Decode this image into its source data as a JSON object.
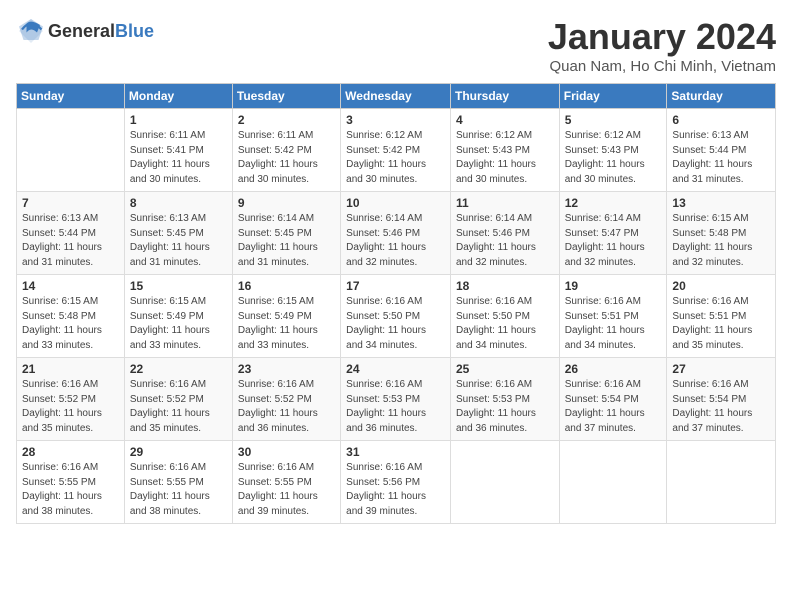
{
  "header": {
    "logo": {
      "text_general": "General",
      "text_blue": "Blue"
    },
    "title": "January 2024",
    "location": "Quan Nam, Ho Chi Minh, Vietnam"
  },
  "calendar": {
    "weekdays": [
      "Sunday",
      "Monday",
      "Tuesday",
      "Wednesday",
      "Thursday",
      "Friday",
      "Saturday"
    ],
    "weeks": [
      [
        {
          "day": "",
          "sunrise": "",
          "sunset": "",
          "daylight": ""
        },
        {
          "day": "1",
          "sunrise": "Sunrise: 6:11 AM",
          "sunset": "Sunset: 5:41 PM",
          "daylight": "Daylight: 11 hours and 30 minutes."
        },
        {
          "day": "2",
          "sunrise": "Sunrise: 6:11 AM",
          "sunset": "Sunset: 5:42 PM",
          "daylight": "Daylight: 11 hours and 30 minutes."
        },
        {
          "day": "3",
          "sunrise": "Sunrise: 6:12 AM",
          "sunset": "Sunset: 5:42 PM",
          "daylight": "Daylight: 11 hours and 30 minutes."
        },
        {
          "day": "4",
          "sunrise": "Sunrise: 6:12 AM",
          "sunset": "Sunset: 5:43 PM",
          "daylight": "Daylight: 11 hours and 30 minutes."
        },
        {
          "day": "5",
          "sunrise": "Sunrise: 6:12 AM",
          "sunset": "Sunset: 5:43 PM",
          "daylight": "Daylight: 11 hours and 30 minutes."
        },
        {
          "day": "6",
          "sunrise": "Sunrise: 6:13 AM",
          "sunset": "Sunset: 5:44 PM",
          "daylight": "Daylight: 11 hours and 31 minutes."
        }
      ],
      [
        {
          "day": "7",
          "sunrise": "Sunrise: 6:13 AM",
          "sunset": "Sunset: 5:44 PM",
          "daylight": "Daylight: 11 hours and 31 minutes."
        },
        {
          "day": "8",
          "sunrise": "Sunrise: 6:13 AM",
          "sunset": "Sunset: 5:45 PM",
          "daylight": "Daylight: 11 hours and 31 minutes."
        },
        {
          "day": "9",
          "sunrise": "Sunrise: 6:14 AM",
          "sunset": "Sunset: 5:45 PM",
          "daylight": "Daylight: 11 hours and 31 minutes."
        },
        {
          "day": "10",
          "sunrise": "Sunrise: 6:14 AM",
          "sunset": "Sunset: 5:46 PM",
          "daylight": "Daylight: 11 hours and 32 minutes."
        },
        {
          "day": "11",
          "sunrise": "Sunrise: 6:14 AM",
          "sunset": "Sunset: 5:46 PM",
          "daylight": "Daylight: 11 hours and 32 minutes."
        },
        {
          "day": "12",
          "sunrise": "Sunrise: 6:14 AM",
          "sunset": "Sunset: 5:47 PM",
          "daylight": "Daylight: 11 hours and 32 minutes."
        },
        {
          "day": "13",
          "sunrise": "Sunrise: 6:15 AM",
          "sunset": "Sunset: 5:48 PM",
          "daylight": "Daylight: 11 hours and 32 minutes."
        }
      ],
      [
        {
          "day": "14",
          "sunrise": "Sunrise: 6:15 AM",
          "sunset": "Sunset: 5:48 PM",
          "daylight": "Daylight: 11 hours and 33 minutes."
        },
        {
          "day": "15",
          "sunrise": "Sunrise: 6:15 AM",
          "sunset": "Sunset: 5:49 PM",
          "daylight": "Daylight: 11 hours and 33 minutes."
        },
        {
          "day": "16",
          "sunrise": "Sunrise: 6:15 AM",
          "sunset": "Sunset: 5:49 PM",
          "daylight": "Daylight: 11 hours and 33 minutes."
        },
        {
          "day": "17",
          "sunrise": "Sunrise: 6:16 AM",
          "sunset": "Sunset: 5:50 PM",
          "daylight": "Daylight: 11 hours and 34 minutes."
        },
        {
          "day": "18",
          "sunrise": "Sunrise: 6:16 AM",
          "sunset": "Sunset: 5:50 PM",
          "daylight": "Daylight: 11 hours and 34 minutes."
        },
        {
          "day": "19",
          "sunrise": "Sunrise: 6:16 AM",
          "sunset": "Sunset: 5:51 PM",
          "daylight": "Daylight: 11 hours and 34 minutes."
        },
        {
          "day": "20",
          "sunrise": "Sunrise: 6:16 AM",
          "sunset": "Sunset: 5:51 PM",
          "daylight": "Daylight: 11 hours and 35 minutes."
        }
      ],
      [
        {
          "day": "21",
          "sunrise": "Sunrise: 6:16 AM",
          "sunset": "Sunset: 5:52 PM",
          "daylight": "Daylight: 11 hours and 35 minutes."
        },
        {
          "day": "22",
          "sunrise": "Sunrise: 6:16 AM",
          "sunset": "Sunset: 5:52 PM",
          "daylight": "Daylight: 11 hours and 35 minutes."
        },
        {
          "day": "23",
          "sunrise": "Sunrise: 6:16 AM",
          "sunset": "Sunset: 5:52 PM",
          "daylight": "Daylight: 11 hours and 36 minutes."
        },
        {
          "day": "24",
          "sunrise": "Sunrise: 6:16 AM",
          "sunset": "Sunset: 5:53 PM",
          "daylight": "Daylight: 11 hours and 36 minutes."
        },
        {
          "day": "25",
          "sunrise": "Sunrise: 6:16 AM",
          "sunset": "Sunset: 5:53 PM",
          "daylight": "Daylight: 11 hours and 36 minutes."
        },
        {
          "day": "26",
          "sunrise": "Sunrise: 6:16 AM",
          "sunset": "Sunset: 5:54 PM",
          "daylight": "Daylight: 11 hours and 37 minutes."
        },
        {
          "day": "27",
          "sunrise": "Sunrise: 6:16 AM",
          "sunset": "Sunset: 5:54 PM",
          "daylight": "Daylight: 11 hours and 37 minutes."
        }
      ],
      [
        {
          "day": "28",
          "sunrise": "Sunrise: 6:16 AM",
          "sunset": "Sunset: 5:55 PM",
          "daylight": "Daylight: 11 hours and 38 minutes."
        },
        {
          "day": "29",
          "sunrise": "Sunrise: 6:16 AM",
          "sunset": "Sunset: 5:55 PM",
          "daylight": "Daylight: 11 hours and 38 minutes."
        },
        {
          "day": "30",
          "sunrise": "Sunrise: 6:16 AM",
          "sunset": "Sunset: 5:55 PM",
          "daylight": "Daylight: 11 hours and 39 minutes."
        },
        {
          "day": "31",
          "sunrise": "Sunrise: 6:16 AM",
          "sunset": "Sunset: 5:56 PM",
          "daylight": "Daylight: 11 hours and 39 minutes."
        },
        {
          "day": "",
          "sunrise": "",
          "sunset": "",
          "daylight": ""
        },
        {
          "day": "",
          "sunrise": "",
          "sunset": "",
          "daylight": ""
        },
        {
          "day": "",
          "sunrise": "",
          "sunset": "",
          "daylight": ""
        }
      ]
    ]
  }
}
